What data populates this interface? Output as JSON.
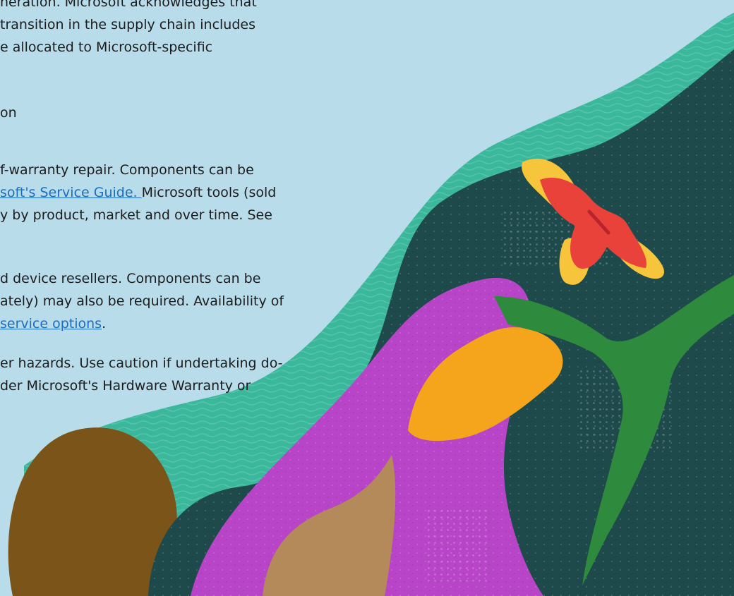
{
  "page": {
    "background_color": "#b9dcea",
    "text_color": "#1c1c1c",
    "link_color": "#1a6ec1"
  },
  "document": {
    "intro_lines": [
      "neration. Microsoft acknowledges that",
      " transition in the supply chain includes",
      "e allocated to Microsoft-specific"
    ],
    "heading_fragment": "on",
    "self_repair": {
      "line1": "f-warranty repair. Components can be",
      "guide_link": "soft's Service Guide. ",
      "line2_tail": "Microsoft tools (sold",
      "line3": "y by product, market and over time. See"
    },
    "reseller_repair": {
      "line1": "d device resellers. Components can be",
      "line2": "ately) may also be required. Availability of",
      "service_link": "service options",
      "line3_tail": "."
    },
    "hazards": {
      "line1": "er hazards. Use caution if undertaking do-",
      "line2": "der Microsoft's Hardware Warranty or"
    }
  },
  "illustration": {
    "colors": {
      "sky": "#b9dcea",
      "teal_wave": "#3bb89c",
      "dark_teal": "#1f4a4b",
      "magenta": "#b845c8",
      "orange": "#f5a51b",
      "brown": "#7a5418",
      "tan": "#b58a5a",
      "leaf_green": "#2e8a3c",
      "butterfly_yellow": "#f7c53b",
      "butterfly_red": "#e9423a"
    },
    "icon_name": "butterfly-icon"
  }
}
